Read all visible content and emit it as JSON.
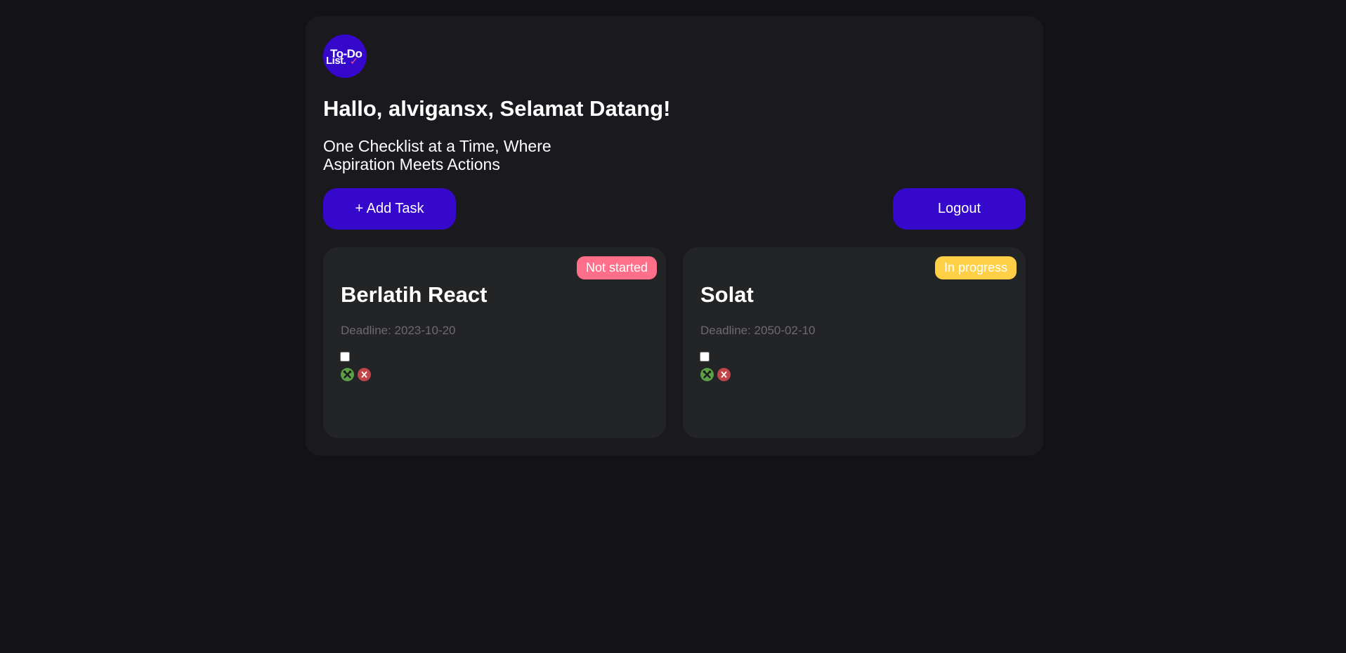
{
  "header": {
    "logo_line1": "To-Do",
    "logo_line2": "List.",
    "logo_check": "✓",
    "greeting": "Hallo, alvigansx, Selamat Datang!",
    "tagline": "One Checklist at a Time, Where Aspiration Meets Actions"
  },
  "actions": {
    "add_task_label": "+ Add Task",
    "logout_label": "Logout"
  },
  "tasks": [
    {
      "title": "Berlatih React",
      "status": "Not started",
      "status_color": "#ff6f8a",
      "deadline": "Deadline: 2023-10-20",
      "done": false,
      "edit_icon": "wrench-cross-icon",
      "delete_icon": "x-icon"
    },
    {
      "title": "Solat",
      "status": "In progress",
      "status_color": "#ffd046",
      "deadline": "Deadline: 2050-02-10",
      "done": false,
      "edit_icon": "wrench-cross-icon",
      "delete_icon": "x-icon"
    }
  ],
  "colors": {
    "background": "#131315",
    "panel": "#1a1a1e",
    "card": "#232426",
    "accent": "#3508cc",
    "edit_icon": "#5ba046",
    "delete_icon": "#c0464a"
  }
}
